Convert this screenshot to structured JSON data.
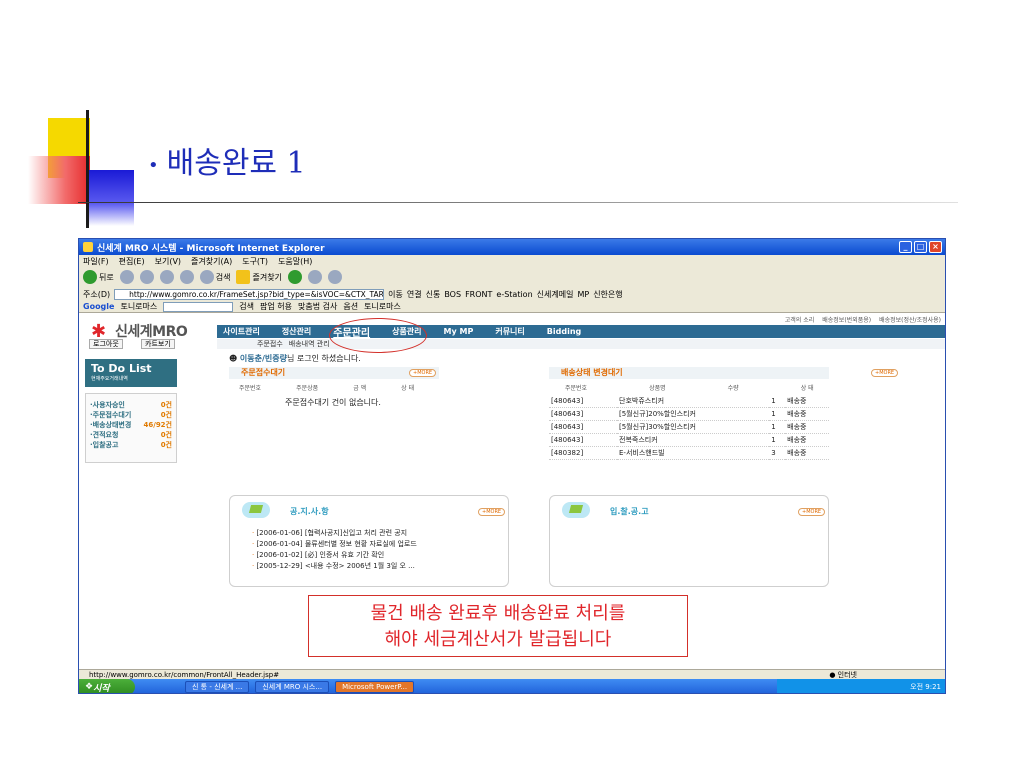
{
  "slide": {
    "title": "배송완료 1",
    "callout_line1": "물건 배송 완료후 배송완료 처리를",
    "callout_line2": "해야 세금계산서가 발급됩니다"
  },
  "window": {
    "title": "신세계 MRO 시스템 - Microsoft Internet Explorer",
    "menu": [
      "파일(F)",
      "편집(E)",
      "보기(V)",
      "즐겨찾기(A)",
      "도구(T)",
      "도움말(H)"
    ],
    "toolbar": {
      "back": "뒤로",
      "search": "검색",
      "favorites": "즐겨찾기"
    },
    "address": {
      "label": "주소(D)",
      "url": "http://www.gomro.co.kr/FrameSet.jsp?bid_type=&isVOC=&CTX_TARGE",
      "go": "이동",
      "links_label": "연결",
      "links": [
        "신통",
        "BOS",
        "FRONT",
        "e-Station",
        "신세계메일",
        "MP",
        "신한은행"
      ]
    },
    "google": {
      "label": "Google",
      "dropdown": "토니로마스",
      "search": "검색",
      "popup": "팝업 허용",
      "spell": "맞춤법 검사",
      "options": "옵션",
      "bookmark": "토니로마스"
    }
  },
  "site": {
    "logo": "신세계MRO",
    "logout": "로그아웃",
    "cart": "카트보기",
    "top_links": [
      "고객의 소리",
      "배송정보(번외품용)",
      "배송정보(정산/조정사용)"
    ],
    "nav": [
      "사이트관리",
      "정산관리",
      "주문관리",
      "상품관리",
      "My MP",
      "커뮤니티",
      "Bidding"
    ],
    "subnav": [
      "주문접수",
      "배송내역 관리"
    ]
  },
  "todo": {
    "title": "To Do List",
    "subtitle": "현재주요거래내역",
    "items": [
      {
        "label": "·사용자승인",
        "count": "0건"
      },
      {
        "label": "·주문접수대기",
        "count": "0건"
      },
      {
        "label": "·배송상태변경",
        "count": "46/92건"
      },
      {
        "label": "·견적요청",
        "count": "0건"
      },
      {
        "label": "·입찰공고",
        "count": "0건"
      }
    ]
  },
  "welcome": {
    "name": "이동춘/빈중량",
    "suffix": "님 로그인 하셨습니다."
  },
  "order_wait": {
    "title": "주문접수대기",
    "more": "+MORE",
    "columns": [
      "주문번호",
      "주문상품",
      "금 액",
      "상 태"
    ],
    "empty": "주문접수대기 건이 없습니다."
  },
  "ship_change": {
    "title": "배송상태 변경대기",
    "more": "+MORE",
    "columns": [
      "주문번호",
      "상품명",
      "수량",
      "상 태"
    ],
    "rows": [
      {
        "order": "[480643]",
        "product": "단호박쥬스티커",
        "qty": "1",
        "status": "배송중"
      },
      {
        "order": "[480643]",
        "product": "[5월신규]20%할인스티커",
        "qty": "1",
        "status": "배송중"
      },
      {
        "order": "[480643]",
        "product": "[5월신규]30%할인스티커",
        "qty": "1",
        "status": "배송중"
      },
      {
        "order": "[480643]",
        "product": "전복죽스티커",
        "qty": "1",
        "status": "배송중"
      },
      {
        "order": "[480382]",
        "product": "E-서비스핸드빌",
        "qty": "3",
        "status": "배송중"
      }
    ]
  },
  "notice": {
    "title": "공.지.사.항",
    "more": "+MORE",
    "items": [
      "[2006-01-06] [협력사공지]신입고 처리 관련 공지",
      "[2006-01-04] 물류센터별 정보 현황 자료실에 업로드",
      "[2006-01-02] [必] 인증서 유효 기간 확인",
      "[2005-12-29] <내용 수정> 2006년 1월 3일 오 ..."
    ]
  },
  "bid": {
    "title": "입.찰.공.고",
    "more": "+MORE"
  },
  "statusbar": {
    "url": "http://www.gomro.co.kr/common/FrontAll_Header.jsp#",
    "zone": "인터넷"
  },
  "taskbar": {
    "start": "시작",
    "items": [
      "신 통 - 신세계 ...",
      "신세계 MRO 시스...",
      "Microsoft PowerP..."
    ],
    "clock": "오전 9:21"
  }
}
